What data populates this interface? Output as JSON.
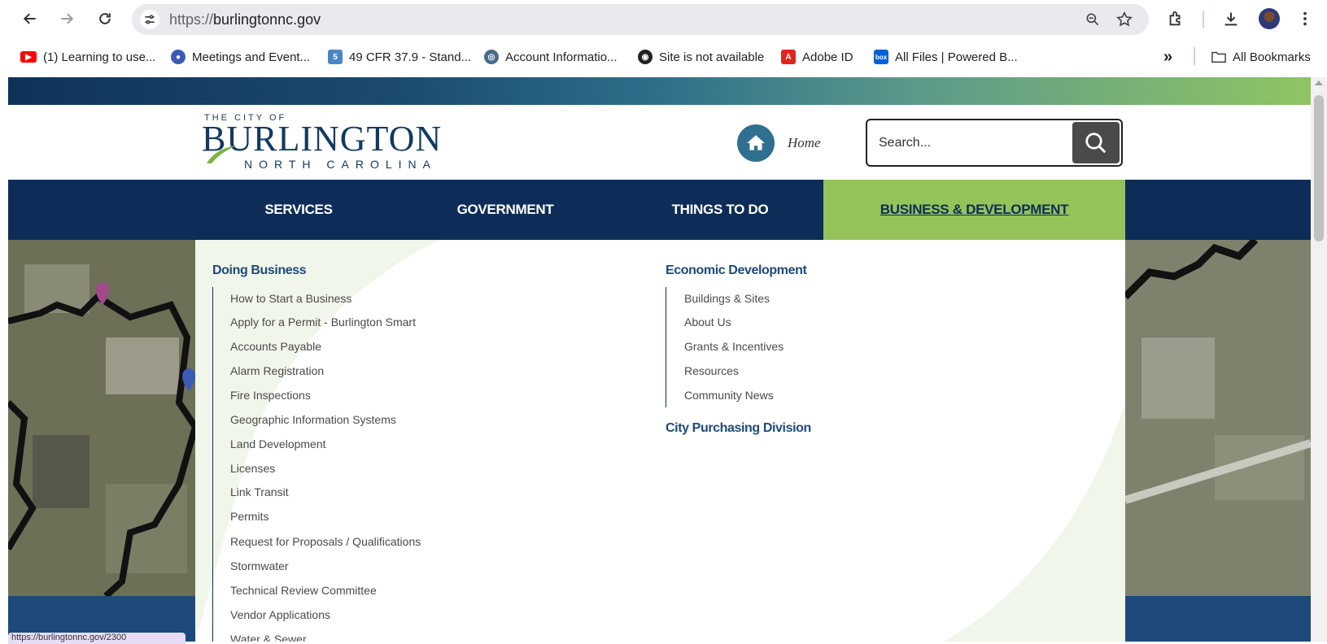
{
  "browser": {
    "url_scheme": "https://",
    "url_host": "burlingtonnc.gov",
    "bookmarks": [
      {
        "label": "(1) Learning to use...",
        "icon": "youtube-icon",
        "color": "#ff0000"
      },
      {
        "label": "Meetings and Event...",
        "icon": "meetings-icon",
        "color": "#3b5bb5"
      },
      {
        "label": "49 CFR 37.9 - Stand...",
        "icon": "cfr-icon",
        "color": "#4a86c5"
      },
      {
        "label": "Account Informatio...",
        "icon": "account-icon",
        "color": "#4a6b8a"
      },
      {
        "label": "Site is not available",
        "icon": "globe-icon",
        "color": "#222222"
      },
      {
        "label": "Adobe ID",
        "icon": "adobe-icon",
        "color": "#e1251b"
      },
      {
        "label": "All Files | Powered B...",
        "icon": "box-icon",
        "color": "#0061d5"
      }
    ],
    "more_bookmarks": "»",
    "all_bookmarks": "All Bookmarks"
  },
  "site": {
    "logo": {
      "small": "THE CITY OF",
      "big": "BURLINGTON",
      "sub": "NORTH CAROLINA"
    },
    "home_label": "Home",
    "search_placeholder": "Search...",
    "menu": [
      {
        "label": "SERVICES"
      },
      {
        "label": "GOVERNMENT"
      },
      {
        "label": "THINGS TO DO"
      },
      {
        "label": "BUSINESS & DEVELOPMENT",
        "active": true
      }
    ],
    "colors": {
      "navy": "#0d2d58",
      "green": "#94c359",
      "heading_blue": "#1f4a7a"
    }
  },
  "dropdown": {
    "doing_business": {
      "title": "Doing Business",
      "links": [
        "How to Start a Business",
        "Apply for a Permit - Burlington Smart",
        "Accounts Payable",
        "Alarm Registration",
        "Fire Inspections",
        "Geographic Information Systems",
        "Land Development",
        "Licenses",
        "Link Transit",
        "Permits",
        "Request for Proposals / Qualifications",
        "Stormwater",
        "Technical Review Committee",
        "Vendor Applications",
        "Water & Sewer"
      ]
    },
    "economic_development": {
      "title": "Economic Development",
      "links": [
        "Buildings & Sites",
        "About Us",
        "Grants & Incentives",
        "Resources",
        "Community News"
      ]
    },
    "city_purchasing": {
      "title": "City Purchasing Division"
    }
  },
  "status_bar_text": "https://burlingtonnc.gov/2300"
}
